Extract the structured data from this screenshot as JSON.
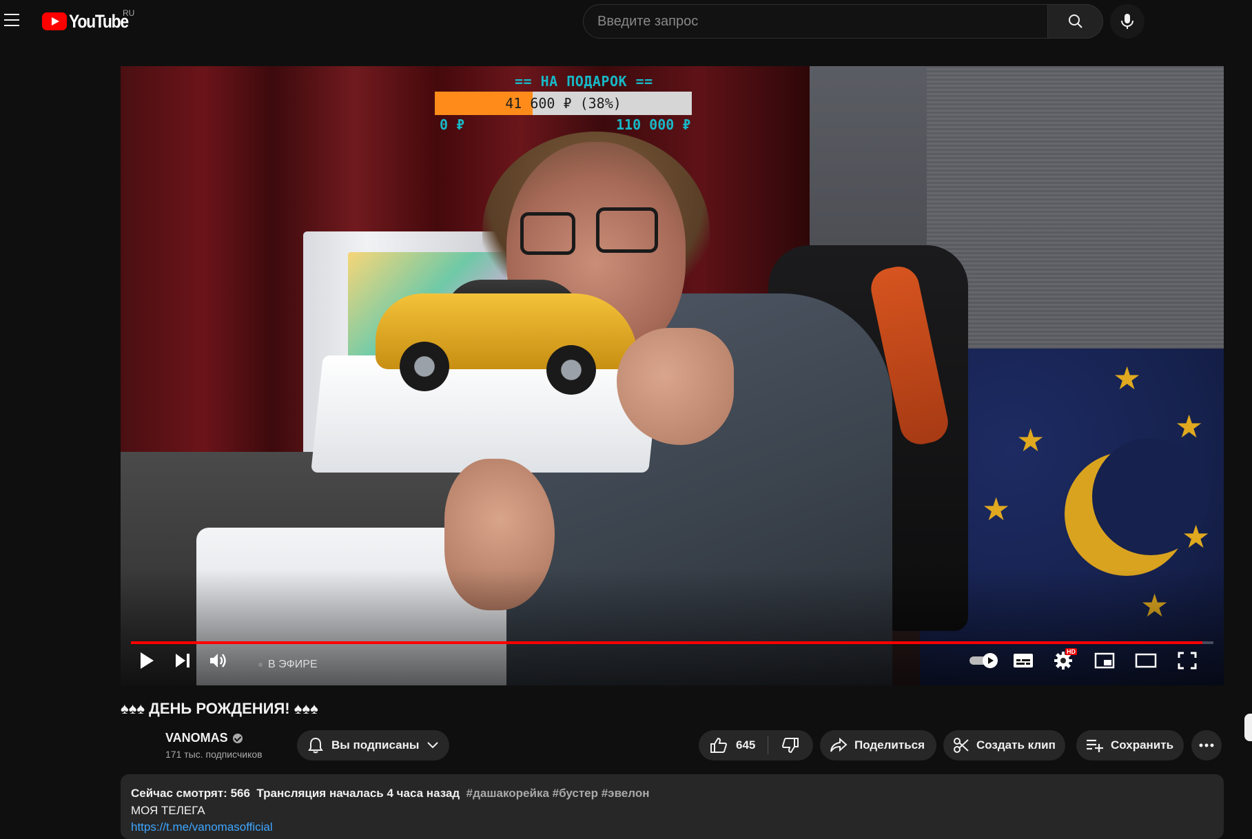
{
  "header": {
    "logo_text": "YouTube",
    "country_code": "RU",
    "search_placeholder": "Введите запрос",
    "search_value": ""
  },
  "player": {
    "donation": {
      "title": "== НА ПОДАРОК ==",
      "progress_text": "41 600 ₽ (38%)",
      "progress_fraction": 0.38,
      "min_label": "0 ₽",
      "max_label": "110 000 ₽"
    },
    "live_label": "В ЭФИРЕ",
    "progress_fraction": 0.99,
    "settings_badge": "HD"
  },
  "video": {
    "title": "♠♠♠ ДЕНЬ РОЖДЕНИЯ! ♠♠♠",
    "channel_name": "VANOMAS",
    "subscribers": "171 тыс. подписчиков",
    "subscribe_label": "Вы подписаны",
    "likes": "645",
    "share_label": "Поделиться",
    "clip_label": "Создать клип",
    "save_label": "Сохранить"
  },
  "description": {
    "viewers": "Сейчас смотрят: 566",
    "started": "Трансляция началась 4 часа назад",
    "tags": "#дашакорейка #бустер #эвелон",
    "line2": "МОЯ ТЕЛЕГА",
    "link": "https://t.me/vanomasofficial"
  },
  "colors": {
    "accent_red": "#ff0000",
    "donation_orange": "#ff8c1a",
    "donation_cyan": "#18b8c6",
    "link_blue": "#3ea6ff"
  }
}
